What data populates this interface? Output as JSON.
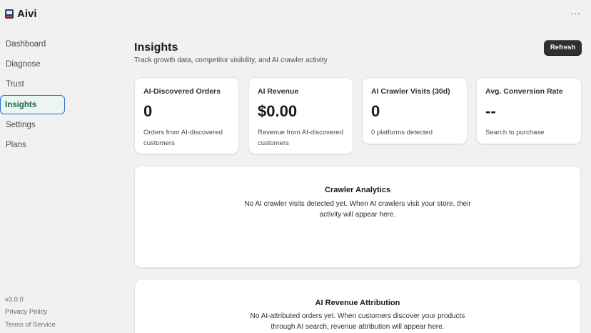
{
  "app": {
    "title": "Aivi",
    "more_glyph": "···"
  },
  "sidebar": {
    "items": [
      {
        "label": "Dashboard"
      },
      {
        "label": "Diagnose"
      },
      {
        "label": "Trust"
      },
      {
        "label": "Insights",
        "active": true
      },
      {
        "label": "Settings"
      },
      {
        "label": "Plans"
      }
    ],
    "version": "v3.0.0",
    "privacy_label": "Privacy Policy",
    "terms_label": "Terms of Service"
  },
  "header": {
    "title": "Insights",
    "subtitle": "Track growth data, competitor visibility, and AI crawler activity",
    "refresh_label": "Refresh"
  },
  "stats": [
    {
      "label": "AI-Discovered Orders",
      "value": "0",
      "desc": "Orders from AI-discovered customers"
    },
    {
      "label": "AI Revenue",
      "value": "$0.00",
      "desc": "Revenue from AI-discovered customers"
    },
    {
      "label": "AI Crawler Visits (30d)",
      "value": "0",
      "desc": "0 platforms detected"
    },
    {
      "label": "Avg. Conversion Rate",
      "value": "--",
      "desc": "Search to purchase"
    }
  ],
  "crawler_panel": {
    "title": "Crawler Analytics",
    "text": "No AI crawler visits detected yet. When AI crawlers visit your store, their activity will appear here."
  },
  "revenue_panel": {
    "title": "AI Revenue Attribution",
    "text": "No AI-attributed orders yet. When customers discover your products through AI search, revenue attribution will appear here."
  },
  "colors": {
    "accent": "#2c6ecb",
    "active_bg": "#eaf6ef",
    "active_text": "#16684a",
    "button_bg": "#303030"
  },
  "icons": {
    "logo": "app-logo-icon",
    "more": "more-horizontal-icon"
  }
}
